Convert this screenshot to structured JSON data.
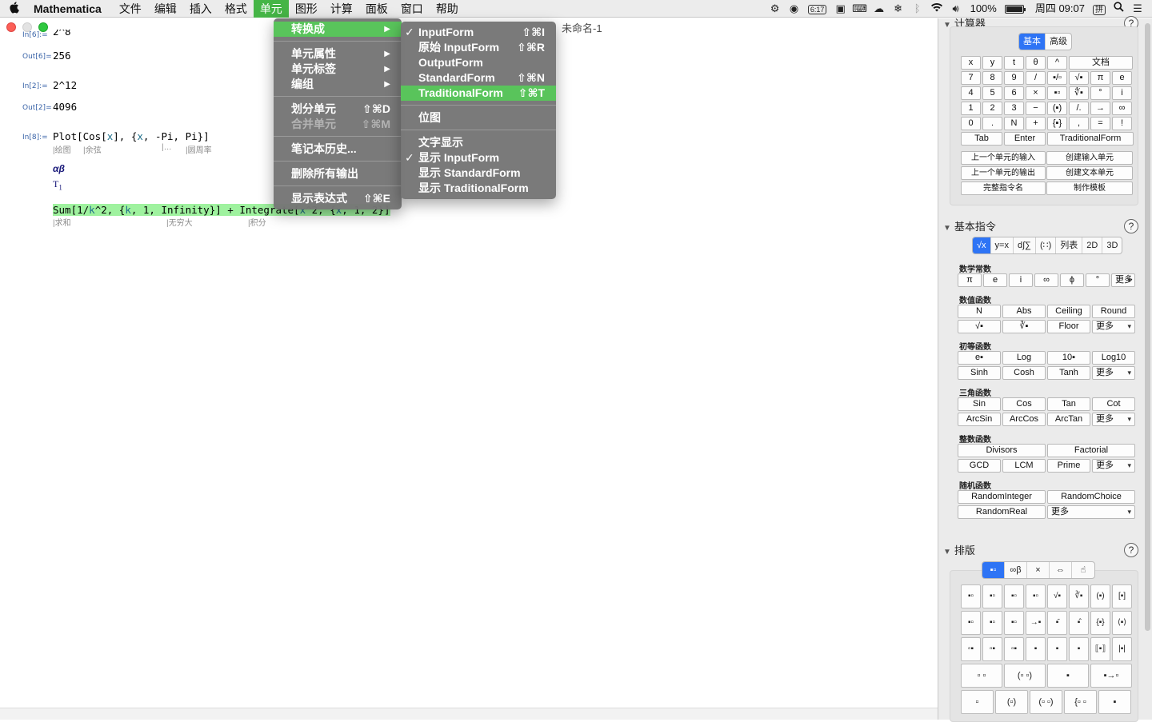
{
  "menubar": {
    "apple": "",
    "app": "Mathematica",
    "items": [
      "文件",
      "编辑",
      "插入",
      "格式",
      "单元",
      "图形",
      "计算",
      "面板",
      "窗口",
      "帮助"
    ],
    "active": "单元",
    "status": {
      "clock_chip": "6:17",
      "battery": "100%",
      "battery_level": 1.0,
      "datetime": "周四 09:07",
      "input_method": "拼"
    }
  },
  "window": {
    "title": "未命名-1"
  },
  "notebook": {
    "cells": [
      {
        "label": "In[6]:=",
        "code": "2^8"
      },
      {
        "label": "Out[6]=",
        "code": "256"
      },
      {
        "label": "In[2]:=",
        "code": "2^12"
      },
      {
        "label": "Out[2]=",
        "code": "4096"
      },
      {
        "label": "In[8]:=",
        "code_parts": [
          "Plot[Cos[",
          "x",
          "], {",
          "x",
          ", -Pi, Pi}]"
        ]
      }
    ],
    "plot_hints": [
      "绘图",
      "余弦",
      "…",
      "圆周率"
    ],
    "greek": "αβ",
    "t_sub": {
      "base": "T",
      "sub": "1"
    },
    "sum_parts": [
      "Sum[1/",
      "k",
      "^2, {",
      "k",
      ", 1, Infinity}] + Integrate[",
      "x",
      "^2, {",
      "x",
      ", 1, 2}]"
    ],
    "sum_hints": [
      "求和",
      "无穷大",
      "积分"
    ]
  },
  "cell_menu": {
    "items": [
      {
        "label": "转换成",
        "arrow": true,
        "highlight": true
      },
      {
        "sep": true
      },
      {
        "label": "单元属性",
        "arrow": true
      },
      {
        "label": "单元标签",
        "arrow": true
      },
      {
        "label": "编组",
        "arrow": true
      },
      {
        "sep": true
      },
      {
        "label": "划分单元",
        "shortcut": "⇧⌘D"
      },
      {
        "label": "合并单元",
        "shortcut": "⇧⌘M",
        "disabled": true
      },
      {
        "sep": true
      },
      {
        "label": "笔记本历史..."
      },
      {
        "sep": true
      },
      {
        "label": "删除所有输出"
      },
      {
        "sep": true
      },
      {
        "label": "显示表达式",
        "shortcut": "⇧⌘E"
      }
    ]
  },
  "convert_menu": {
    "items": [
      {
        "label": "InputForm",
        "shortcut": "⇧⌘I",
        "checked": true
      },
      {
        "label": "原始 InputForm",
        "shortcut": "⇧⌘R"
      },
      {
        "label": "OutputForm"
      },
      {
        "label": "StandardForm",
        "shortcut": "⇧⌘N"
      },
      {
        "label": "TraditionalForm",
        "shortcut": "⇧⌘T",
        "highlight": true
      },
      {
        "sep": true
      },
      {
        "label": "位图"
      },
      {
        "sep": true
      },
      {
        "label": "文字显示"
      },
      {
        "label": "显示 InputForm",
        "checked": true
      },
      {
        "label": "显示 StandardForm"
      },
      {
        "label": "显示 TraditionalForm"
      }
    ]
  },
  "palette": {
    "calculator": {
      "title": "计算器",
      "tabs": [
        "基本",
        "高级"
      ],
      "active_tab": "基本",
      "keys": [
        [
          "x",
          "y",
          "t",
          "θ",
          "^",
          "文档"
        ],
        [
          "7",
          "8",
          "9",
          "/",
          "▪/▫",
          "√▪",
          "π",
          "e"
        ],
        [
          "4",
          "5",
          "6",
          "×",
          "▪▫",
          "∜▪",
          "°",
          "i"
        ],
        [
          "1",
          "2",
          "3",
          "−",
          "(▪)",
          "/.",
          "→",
          "∞"
        ],
        [
          "0",
          ".",
          "N",
          "+",
          "{▪}",
          ",",
          "=",
          "!"
        ],
        [
          "Tab",
          "Enter",
          "TraditionalForm"
        ]
      ],
      "actions": [
        "上一个单元的输入",
        "创建输入单元",
        "上一个单元的输出",
        "创建文本单元",
        "完整指令名",
        "制作模板"
      ]
    },
    "basic": {
      "title": "基本指令",
      "tabs": [
        "√x",
        "y=x",
        "d∫∑",
        "(∷)",
        "列表",
        "2D",
        "3D"
      ],
      "categories": [
        {
          "name": "数学常数",
          "rows": [
            [
              "π",
              "e",
              "i",
              "∞",
              "ϕ",
              "°",
              "更多"
            ]
          ]
        },
        {
          "name": "数值函数",
          "rows": [
            [
              "N",
              "Abs",
              "Ceiling",
              "Round"
            ],
            [
              "√▪",
              "∛▪",
              "Floor",
              "更多"
            ]
          ]
        },
        {
          "name": "初等函数",
          "rows": [
            [
              "e▪",
              "Log",
              "10▪",
              "Log10"
            ],
            [
              "Sinh",
              "Cosh",
              "Tanh",
              "更多"
            ]
          ]
        },
        {
          "name": "三角函数",
          "rows": [
            [
              "Sin",
              "Cos",
              "Tan",
              "Cot"
            ],
            [
              "ArcSin",
              "ArcCos",
              "ArcTan",
              "更多"
            ]
          ]
        },
        {
          "name": "整数函数",
          "rows": [
            [
              "Divisors",
              "Factorial"
            ],
            [
              "GCD",
              "LCM",
              "Prime",
              "更多"
            ]
          ]
        },
        {
          "name": "随机函数",
          "rows": [
            [
              "RandomInteger",
              "RandomChoice"
            ],
            [
              "RandomReal",
              "更多"
            ]
          ]
        }
      ]
    },
    "typeset": {
      "title": "排版",
      "tabs": [
        "▪▫",
        "∞β",
        "×",
        "⇔",
        "☝"
      ],
      "rows": [
        [
          "▪▫",
          "▪▫",
          "▪▫",
          "▪▫",
          "√▪",
          "∛▪",
          "(▪)",
          "[▪]"
        ],
        [
          "▪▫",
          "▪▫",
          "▪▫",
          "→▪",
          "▪̄",
          "▪̂",
          "{▪}",
          "⟨▪⟩"
        ],
        [
          "▫▪",
          "▫▪",
          "▫▪",
          "▪",
          "▪",
          "▪",
          "⟦▪⟧",
          "|▪|"
        ],
        [
          "▫ ▫",
          "(▫ ▫)",
          "▪",
          "▪→▫"
        ],
        [
          "▫",
          "(▫)",
          "(▫ ▫)",
          "{▫ ▫",
          "▪"
        ]
      ]
    }
  },
  "icons": [
    "apple-logo",
    "gear-icon",
    "wechat-icon",
    "clock-icon",
    "screen-icon",
    "keyboard-icon",
    "cloud-icon",
    "snowflake-icon",
    "bluetooth-icon",
    "wifi-icon",
    "volume-icon",
    "battery-icon",
    "search-icon",
    "list-icon",
    "help-icon",
    "checkmark-icon",
    "submenu-arrow-icon"
  ],
  "colors": {
    "menu_highlight": "#59c45b",
    "menubar_active": "#45b546",
    "cell_highlight": "#9ff29f",
    "segment_active": "#2e74f5",
    "label_blue": "#3a64a8"
  }
}
